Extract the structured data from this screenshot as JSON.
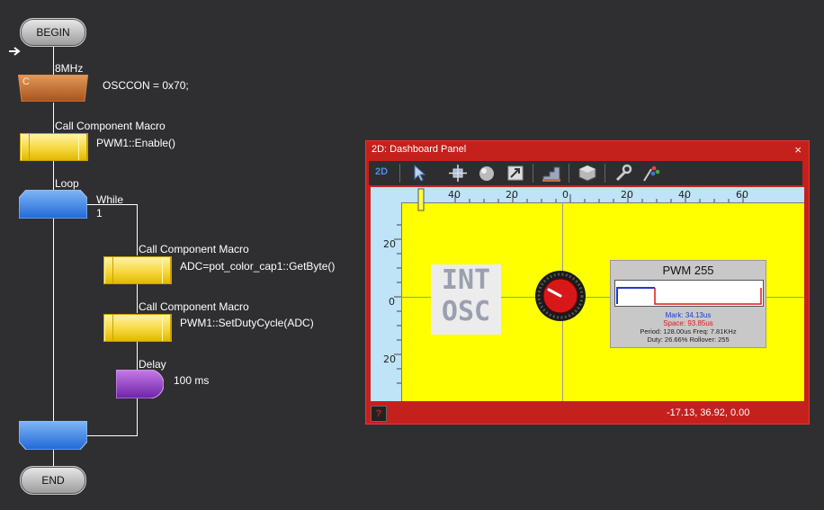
{
  "flowchart": {
    "begin_label": "BEGIN",
    "end_label": "END",
    "clock_label": "8MHz",
    "calc_icon_label": "C",
    "calc_code": "OSCCON = 0x70;",
    "macro1_caption": "Call Component Macro",
    "macro1_code": "PWM1::Enable()",
    "loop_caption": "Loop",
    "loop_while": "While",
    "loop_condition": "1",
    "macro2_caption": "Call Component Macro",
    "macro2_code": "ADC=pot_color_cap1::GetByte()",
    "macro3_caption": "Call Component Macro",
    "macro3_code": "PWM1::SetDutyCycle(ADC)",
    "delay_caption": "Delay",
    "delay_value": "100 ms"
  },
  "panel": {
    "title": "2D: Dashboard Panel",
    "close_symbol": "×",
    "toolbar": {
      "mode_label": "2D",
      "icons": [
        "pointer-icon",
        "move-icon",
        "sphere-icon",
        "resize-icon",
        "stairs-icon",
        "cube-icon",
        "wrench-icon",
        "palette-icon"
      ]
    },
    "ruler": {
      "top_labels": [
        "40",
        "20",
        "0",
        "20",
        "40",
        "60"
      ],
      "left_labels": [
        "20",
        "0",
        "20"
      ]
    },
    "int_osc": {
      "line1": "INT",
      "line2": "OSC"
    },
    "pwm": {
      "title": "PWM 255",
      "mark": "Mark: 34.13us",
      "space": "Space: 93.85us",
      "line3": "Period: 128.00us    Freq: 7.81KHz",
      "line4": "Duty: 26.66%    Rollover: 255"
    },
    "status": {
      "help_symbol": "?",
      "coords": "-17.13, 36.92, 0.00"
    },
    "colors": {
      "frame": "#c4211d",
      "canvas": "#ffff00",
      "ruler": "#bfe3f7"
    }
  }
}
